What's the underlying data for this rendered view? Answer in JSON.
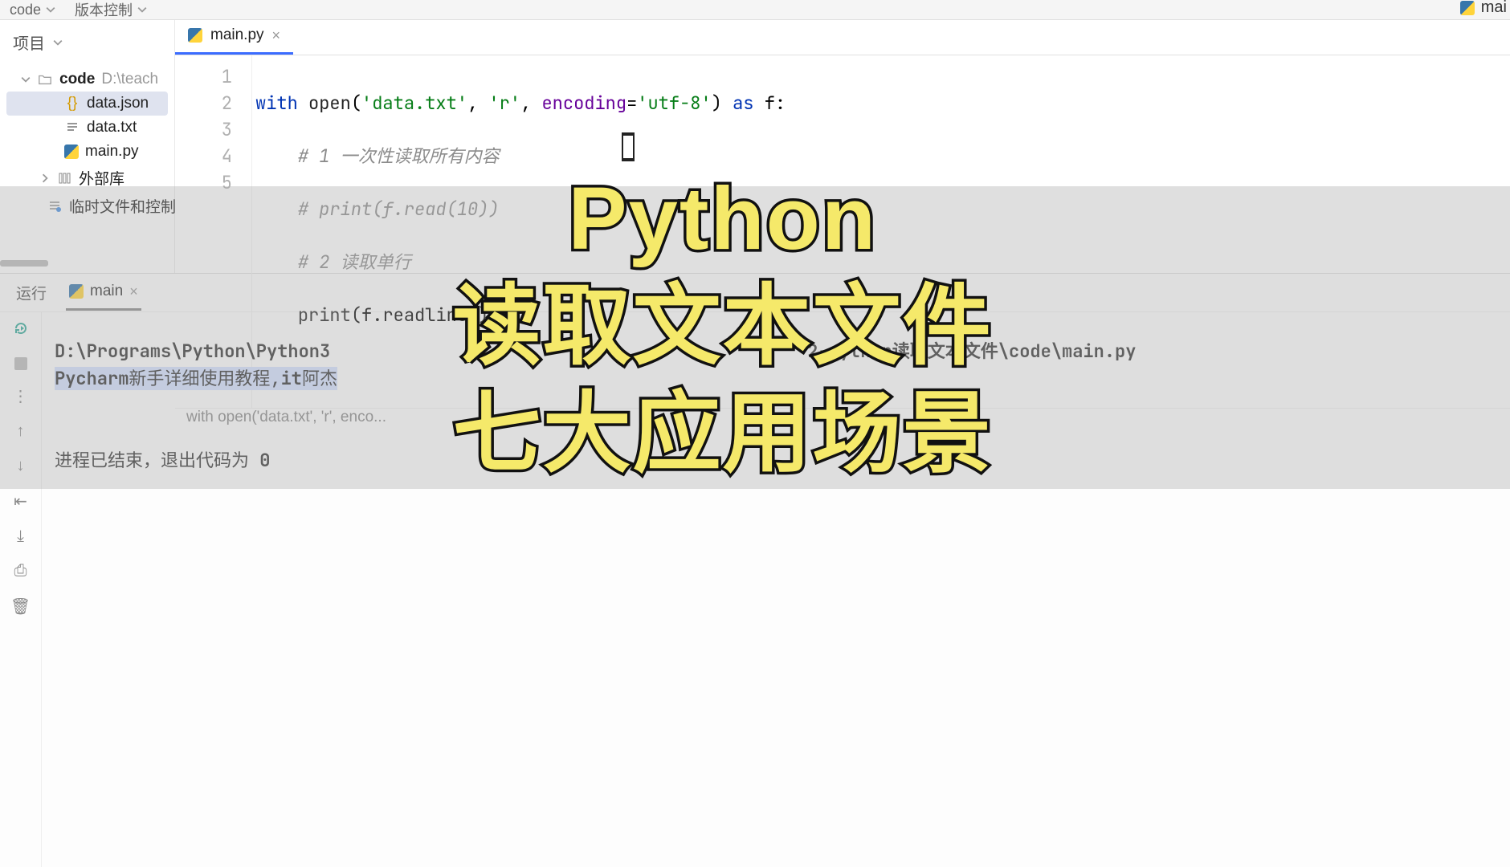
{
  "toolbar": {
    "code": "code",
    "vcs": "版本控制"
  },
  "top_right": {
    "label": "mai"
  },
  "sidebar": {
    "title": "项目",
    "root": "code",
    "root_path": "D:\\teach",
    "files": [
      {
        "name": "data.json",
        "type": "json"
      },
      {
        "name": "data.txt",
        "type": "txt"
      },
      {
        "name": "main.py",
        "type": "py"
      }
    ],
    "lib": "外部库",
    "scratch": "临时文件和控制"
  },
  "tab": {
    "name": "main.py"
  },
  "code": {
    "line_numbers": [
      "1",
      "2",
      "3",
      "4",
      "5"
    ],
    "l1": {
      "kw1": "with",
      "fn": "open",
      "p1": "(",
      "s1": "'data.txt'",
      "c1": ",",
      "s2": "'r'",
      "c2": ",",
      "arg": "encoding",
      "eq": "=",
      "s3": "'utf-8'",
      "p2": ")",
      "kw2": "as",
      "var": "f:",
      "sp1": " ",
      "sp2": " ",
      "sp3": " "
    },
    "l2": "# 1 一次性读取所有内容",
    "l3": "# print(f.read(10))",
    "l4": "# 2 读取单行",
    "l5": {
      "fn": "print",
      "open": "(f.",
      "meth": "readline",
      "close": "())"
    }
  },
  "breadcrumb": "with open('data.txt', 'r', enco...",
  "bottom": {
    "run": "运行",
    "tab": "main",
    "out_path_pre": "D:\\Programs\\Python\\Python3",
    "out_path_post": "2-python读取文本文件\\code\\main.py",
    "out_line2a": "Pycharm",
    "out_line2b": "新手详细使用教程,",
    "out_line2c": "it",
    "out_line2d": "阿杰",
    "exit_pre": "进程已结束，退出代码为 ",
    "exit_code": "0"
  },
  "headline": {
    "l1": "Python",
    "l2": "读取文本文件",
    "l3": "七大应用场景"
  }
}
